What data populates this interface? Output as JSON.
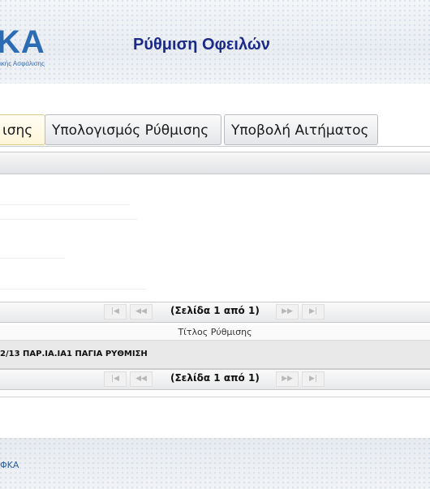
{
  "header": {
    "logo_text": "ΚΑ",
    "logo_subtitle": "ικής Ασφάλισης",
    "page_title": "Ρύθμιση Οφειλών"
  },
  "tabs": [
    {
      "label": "ισης",
      "active": true
    },
    {
      "label": "Υπολογισμός Ρύθμισης",
      "active": false
    },
    {
      "label": "Υποβολή Αιτήματος",
      "active": false
    }
  ],
  "pager_top": {
    "first_icon": "first-page-icon",
    "prev_icon": "prev-page-icon",
    "text": "(Σελίδα 1 από 1)",
    "next_icon": "next-page-icon",
    "last_icon": "last-page-icon"
  },
  "grid": {
    "column_header": "Τίτλος Ρύθμισης",
    "rows": [
      "2/13 ΠΑΡ.ΙΑ.ΙΑ1 ΠΑΓΙΑ ΡΥΘΜΙΣΗ"
    ]
  },
  "pager_bottom": {
    "text": "(Σελίδα 1 από 1)"
  },
  "footer": {
    "text": "ΦΚΑ"
  },
  "colors": {
    "title": "#1b2a88",
    "logo": "#2b6cb5",
    "active_tab": "#fff6d9"
  }
}
